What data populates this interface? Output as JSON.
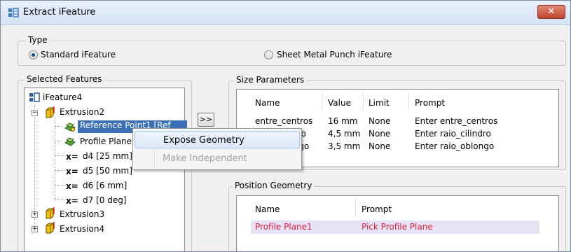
{
  "window": {
    "title": "Extract iFeature",
    "close_label": "✕"
  },
  "type_group": {
    "label": "Type",
    "options": [
      {
        "label": "Standard iFeature",
        "selected": true
      },
      {
        "label": "Sheet Metal Punch iFeature",
        "selected": false
      }
    ]
  },
  "selected_features": {
    "label": "Selected Features",
    "root": "iFeature4",
    "items": [
      {
        "label": "Extrusion2"
      },
      {
        "label": "Reference Point1 [Ref"
      },
      {
        "label": "Profile Plane"
      },
      {
        "label": "d4 [25 mm]"
      },
      {
        "label": "d5 [50 mm]"
      },
      {
        "label": "d6 [6 mm]"
      },
      {
        "label": "d7 [0 deg]"
      },
      {
        "label": "Extrusion3"
      },
      {
        "label": "Extrusion4"
      }
    ],
    "param_prefix": "x="
  },
  "move_button": {
    "label": ">>"
  },
  "size_parameters": {
    "label": "Size Parameters",
    "columns": [
      "Name",
      "Value",
      "Limit",
      "Prompt"
    ],
    "rows": [
      [
        "entre_centros",
        "16 mm",
        "None",
        "Enter entre_centros"
      ],
      [
        "raio_cilindro",
        "4,5 mm",
        "None",
        "Enter raio_cilindro"
      ],
      [
        "raio_oblongo",
        "3,5 mm",
        "None",
        "Enter raio_oblongo"
      ]
    ]
  },
  "position_geometry": {
    "label": "Position Geometry",
    "columns": [
      "Name",
      "Prompt"
    ],
    "rows": [
      [
        "Profile Plane1",
        "Pick Profile Plane"
      ]
    ]
  },
  "context_menu": {
    "items": [
      {
        "label": "Expose Geometry",
        "enabled": true
      },
      {
        "label": "Make Independent",
        "enabled": false
      }
    ]
  },
  "colors": {
    "highlight_text": "#e0203a",
    "row_highlight": "#e6e3f7"
  }
}
